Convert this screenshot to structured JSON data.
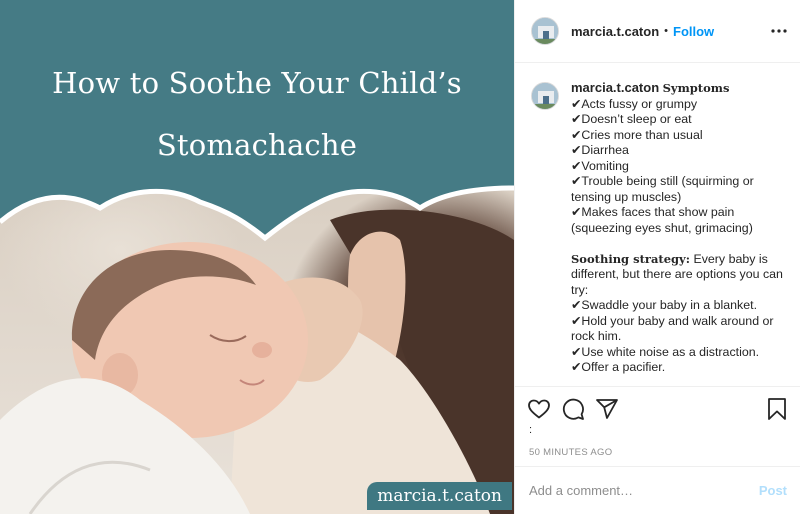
{
  "post_image": {
    "headline_line1": "How to Soothe Your Child’s",
    "headline_line2": "Stomachache",
    "watermark": "marcia.t.caton",
    "header_color": "#457b85"
  },
  "header": {
    "username": "marcia.t.caton",
    "separator": "•",
    "follow_label": "Follow",
    "more_icon": "more-horizontal-icon"
  },
  "caption": {
    "username": "marcia.t.caton",
    "symptoms_heading": "Symptoms",
    "symptoms": [
      "✔Acts fussy or grumpy",
      "✔Doesn’t sleep or eat",
      "✔Cries more than usual",
      "✔Diarrhea",
      "✔Vomiting",
      "✔Trouble being still (squirming or tensing up muscles)",
      "✔Makes faces that show pain (squeezing eyes shut, grimacing)"
    ],
    "strategy_heading": "Soothing strategy:",
    "strategy_text": "Every baby is different, but there are options you can try:",
    "strategies": [
      "✔Swaddle your baby in a blanket.",
      "✔Hold your baby and walk around or rock him.",
      "✔Use white noise as a distraction.",
      "✔Offer a pacifier."
    ]
  },
  "actions": {
    "like_icon": "heart-icon",
    "comment_icon": "comment-icon",
    "share_icon": "share-icon",
    "save_icon": "bookmark-icon",
    "likes_text": ":"
  },
  "timestamp": "50 MINUTES AGO",
  "comment": {
    "placeholder": "Add a comment…",
    "post_label": "Post"
  }
}
